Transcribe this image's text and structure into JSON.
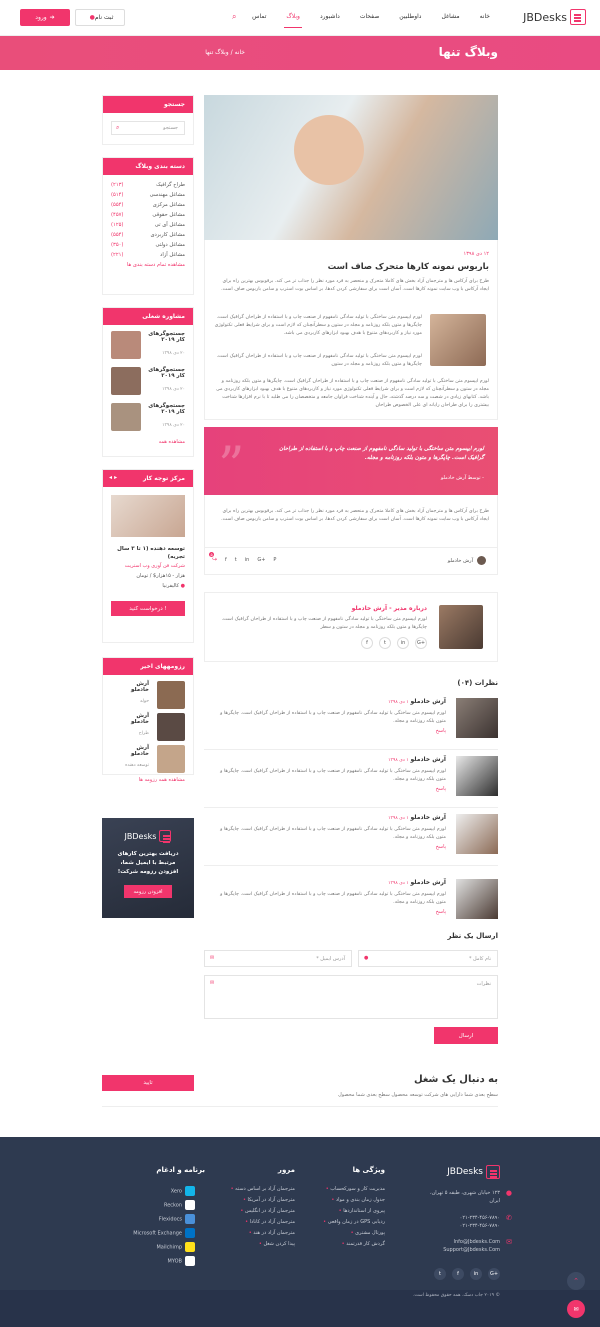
{
  "header": {
    "logo": "JBDesks",
    "nav": [
      "خانه",
      "مشاغل",
      "داوطلبین",
      "صفحات",
      "داشبورد",
      "وبلاگ",
      "تماس"
    ],
    "active": "وبلاگ",
    "register": "ثبت نام",
    "login": "ورود"
  },
  "banner": {
    "title": "وبلاگ تنها",
    "crumb_home": "خانه",
    "crumb_sep": "/",
    "crumb_current": "وبلاگ تنها"
  },
  "sidebar": {
    "search": {
      "title": "جستجو",
      "placeholder": "جستجو"
    },
    "categories": {
      "title": "دسته بندی وبلاگ",
      "items": [
        {
          "label": "طراح گرافیک",
          "count": "(۲۱۳)"
        },
        {
          "label": "مشاغل مهندسی",
          "count": "(۵۱۴)"
        },
        {
          "label": "مشاغل مرکزی",
          "count": "(۵۵۴)"
        },
        {
          "label": "مشاغل حقوقی",
          "count": "(۴۵۷)"
        },
        {
          "label": "مشاغل آی تی",
          "count": "(۱۲۵)"
        },
        {
          "label": "مشاغل کاربردی",
          "count": "(۵۵۴)"
        },
        {
          "label": "مشاغل دولتی",
          "count": "(۳۵۰)"
        },
        {
          "label": "مشاغل آزاد",
          "count": "(۲۲۱)"
        }
      ],
      "more": "مشاهده تمام دسته بندی ها"
    },
    "consult": {
      "title": "مشاوره شغلی",
      "items": [
        {
          "title": "جستجوگرهای کار ۲۰۱۹",
          "date": "۲۰ دی ۱۳۹۸"
        },
        {
          "title": "جستجوگرهای کار ۲۰۱۹",
          "date": "۲۰ دی ۱۳۹۸"
        },
        {
          "title": "جستجوگرهای کار ۲۰۱۹",
          "date": "۲۰ دی ۱۳۹۸"
        }
      ],
      "more": "مشاهده همه"
    },
    "featured": {
      "title": "مرکز توجه کار",
      "job": "توسعه دهنده (۱ تا ۳ سال تجربه)",
      "company": "شرکت فن آوری وب استریت",
      "salary": "هزار - ۱۵هزار$ / تومان",
      "location": "کالیفرنیا",
      "apply": "درخواست کنید !"
    },
    "resumes": {
      "title": "رزومههای اخیر",
      "items": [
        {
          "name": "آرش خادملو",
          "role": "حوله"
        },
        {
          "name": "آرش خادملو",
          "role": "طراح"
        },
        {
          "name": "آرش خادملو",
          "role": "توسعه دهنده"
        }
      ],
      "more": "مشاهده همه رزومه ها"
    },
    "promo": {
      "logo": "JBDesks",
      "text": "دریافت بهترین کارهای مرتبط با ایمیل شما، افزودن رزومه شرکت!",
      "button": "افزودن رزومه"
    }
  },
  "post": {
    "date": "۱۲ دی ۱۳۹۸",
    "title": "باربوس نمونه کارها متحرک صاف است",
    "p1": "طرح برای آرکاس ها و مترجمان آزاد بخش های کاملا متحرک و منحصر به فرد مورد نظر را جذاب تر می کند. برقوبوس بهترین راه برای ایجاد آرکاس با وب سایت نمونه کارها است. آسان است برای سفارشی کردن کدها، بر اساس بوت استرپ و سامن باربوس صاف است.",
    "p2": "لورم ایپسوم متن ساختگی با تولید سادگی نامفهوم از صنعت چاپ و با استفاده از طراحان گرافیک است. چاپگرها و متون بلکه روزنامه و مجله در ستون و سطرآنچنان که لازم است و برای شرایط فعلی تکنولوژی مورد نیاز و کاربردهای متنوع با هدف بهبود ابزارهای کاربردی می باشد.",
    "p3": "لورم ایپسوم متن ساختگی با تولید سادگی نامفهوم از صنعت چاپ و با استفاده از طراحان گرافیک است. چاپگرها و متون بلکه روزنامه و مجله در ستون",
    "p4": "لورم ایپسوم متن ساختگی با تولید سادگی نامفهوم از صنعت چاپ و با استفاده از طراحان گرافیک است. چاپگرها و متون بلکه روزنامه و مجله در ستون و سطرآنچنان که لازم است و برای شرایط فعلی تکنولوژی مورد نیاز و کاربردهای متنوع با هدف بهبود ابزارهای کاربردی می باشد. کتابهای زیادی در شصت و سه درصد گذشته، حال و آینده شناخت فراوان جامعه و متخصصان را می طلبد تا با نرم افزارها شناخت بیشتری را برای طراحان رایانه ای علی الخصوص طراحان",
    "quote": "لورم ایپسوم متن ساختگی با تولید سادگی نامفهوم از صنعت چاپ و با استفاده از طراحان گرافیک است. چاپگرها و متون بلکه روزنامه و مجله.",
    "quote_by": "- توسط آرش خادملو",
    "p5": "طرح برای آرکاس ها و مترجمان آزاد بخش های کاملا متحرک و منحصر به فرد مورد نظر را جذاب تر می کند. برقوبوس بهترین راه برای ایجاد آرکاس با وب سایت نمونه کارها است. آسان است برای سفارشی کردن کدها، بر اساس بوت استرپ و سامن باربوس صاف است.",
    "author": "آرش خادملو",
    "share_count": "۵"
  },
  "about": {
    "title": "درباره مدیر - آرش خادملو",
    "text": "لورم ایپسوم متن ساختگی با تولید سادگی نامفهوم از صنعت چاپ و با استفاده از طراحان گرافیک است. چاپگرها و متون بلکه روزنامه و مجله در ستون و سطر"
  },
  "comments": {
    "title": "نظرات (۰۴)",
    "items": [
      {
        "name": "آرش خادملو",
        "date": "۱ دی ۱۳۹۸",
        "text": "لورم ایپسوم متن ساختگی با تولید سادگی نامفهوم از صنعت چاپ و با استفاده از طراحان گرافیک است. چاپگرها و متون بلکه روزنامه و مجله.",
        "reply": "پاسخ"
      },
      {
        "name": "آرش خادملو",
        "date": "۱ دی ۱۳۹۸",
        "text": "لورم ایپسوم متن ساختگی با تولید سادگی نامفهوم از صنعت چاپ و با استفاده از طراحان گرافیک است. چاپگرها و متون بلکه روزنامه و مجله.",
        "reply": "پاسخ"
      },
      {
        "name": "آرش خادملو",
        "date": "۱ دی ۱۳۹۸",
        "text": "لورم ایپسوم متن ساختگی با تولید سادگی نامفهوم از صنعت چاپ و با استفاده از طراحان گرافیک است. چاپگرها و متون بلکه روزنامه و مجله.",
        "reply": "پاسخ"
      },
      {
        "name": "آرش خادملو",
        "date": "۱ دی ۱۳۹۸",
        "text": "لورم ایپسوم متن ساختگی با تولید سادگی نامفهوم از صنعت چاپ و با استفاده از طراحان گرافیک است. چاپگرها و متون بلکه روزنامه و مجله.",
        "reply": "پاسخ"
      }
    ]
  },
  "form": {
    "title": "ارسال یک نظر",
    "name": "نام کامل *",
    "email": "آدرس ایمیل *",
    "comment": "نظرات",
    "submit": "ارسال"
  },
  "jobsearch": {
    "title": "به دنبال یک شغل",
    "text": "سطح بعدی شما دارایی های شرکت توسعه محصول سطح بعدی شما محصول",
    "button": "تایید"
  },
  "footer": {
    "logo": "JBDesks",
    "address": "۱۲۳ خیابان شهری، طبقه ۵ تهران، ایران",
    "phone1": "۰۲۱-۲۳۴-۴۵۶-۷۸۹۰",
    "phone2": "۰۲۱-۲۳۴-۴۵۶-۷۸۹۰",
    "email1": "Info@Jbdesks.Com",
    "email2": "Support@Jbdesks.Com",
    "features_title": "ویژگی ها",
    "features": [
      "مدیریت کار و سورکحساب",
      "جدول زمان بندی و مواد",
      "پیروی از استانداردها",
      "ردیابی GPS در زمان واقعی",
      "پورتال مشتری",
      "گردش کار قدرتمند"
    ],
    "browse_title": "مرور",
    "browse": [
      "مترجمان آزاد بر اساس دسته",
      "مترجمان آزاد در آمریکا",
      "مترجمان آزاد در انگلیس",
      "مترجمان آزاد در کانادا",
      "مترجمان آزاد در هند",
      "پیدا کردن شغل"
    ],
    "apps_title": "برنامه و ادغام",
    "apps": [
      "Xero",
      "Reckon",
      "Flexidocs",
      "Microsoft Exchange",
      "Mailchimp",
      "MYOB"
    ],
    "copyright": "© ۲۰۱۹ جاب دسک. همه حقوق محفوظ است."
  }
}
